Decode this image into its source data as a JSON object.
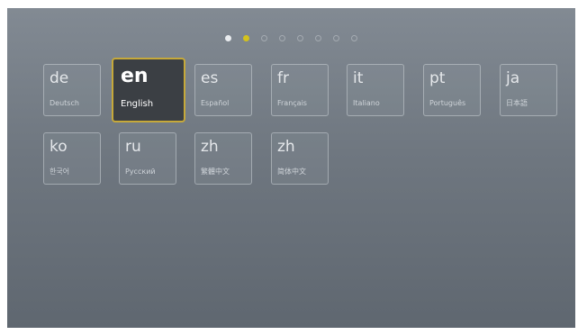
{
  "pager": {
    "total": 8,
    "active_index": 1,
    "colors": {
      "visited": "#e9ecef",
      "active": "#d4c21c"
    }
  },
  "languages": [
    {
      "code": "de",
      "name": "Deutsch"
    },
    {
      "code": "en",
      "name": "English",
      "selected": true
    },
    {
      "code": "es",
      "name": "Español"
    },
    {
      "code": "fr",
      "name": "Français"
    },
    {
      "code": "it",
      "name": "Italiano"
    },
    {
      "code": "pt",
      "name": "Português"
    },
    {
      "code": "ja",
      "name": "日本語"
    },
    {
      "code": "ko",
      "name": "한국어"
    },
    {
      "code": "ru",
      "name": "Русский"
    },
    {
      "code": "zh",
      "name": "繁體中文"
    },
    {
      "code": "zh",
      "name": "简体中文"
    }
  ],
  "colors": {
    "selected_border": "#c6a93a",
    "selected_background": "#3b3f44"
  }
}
